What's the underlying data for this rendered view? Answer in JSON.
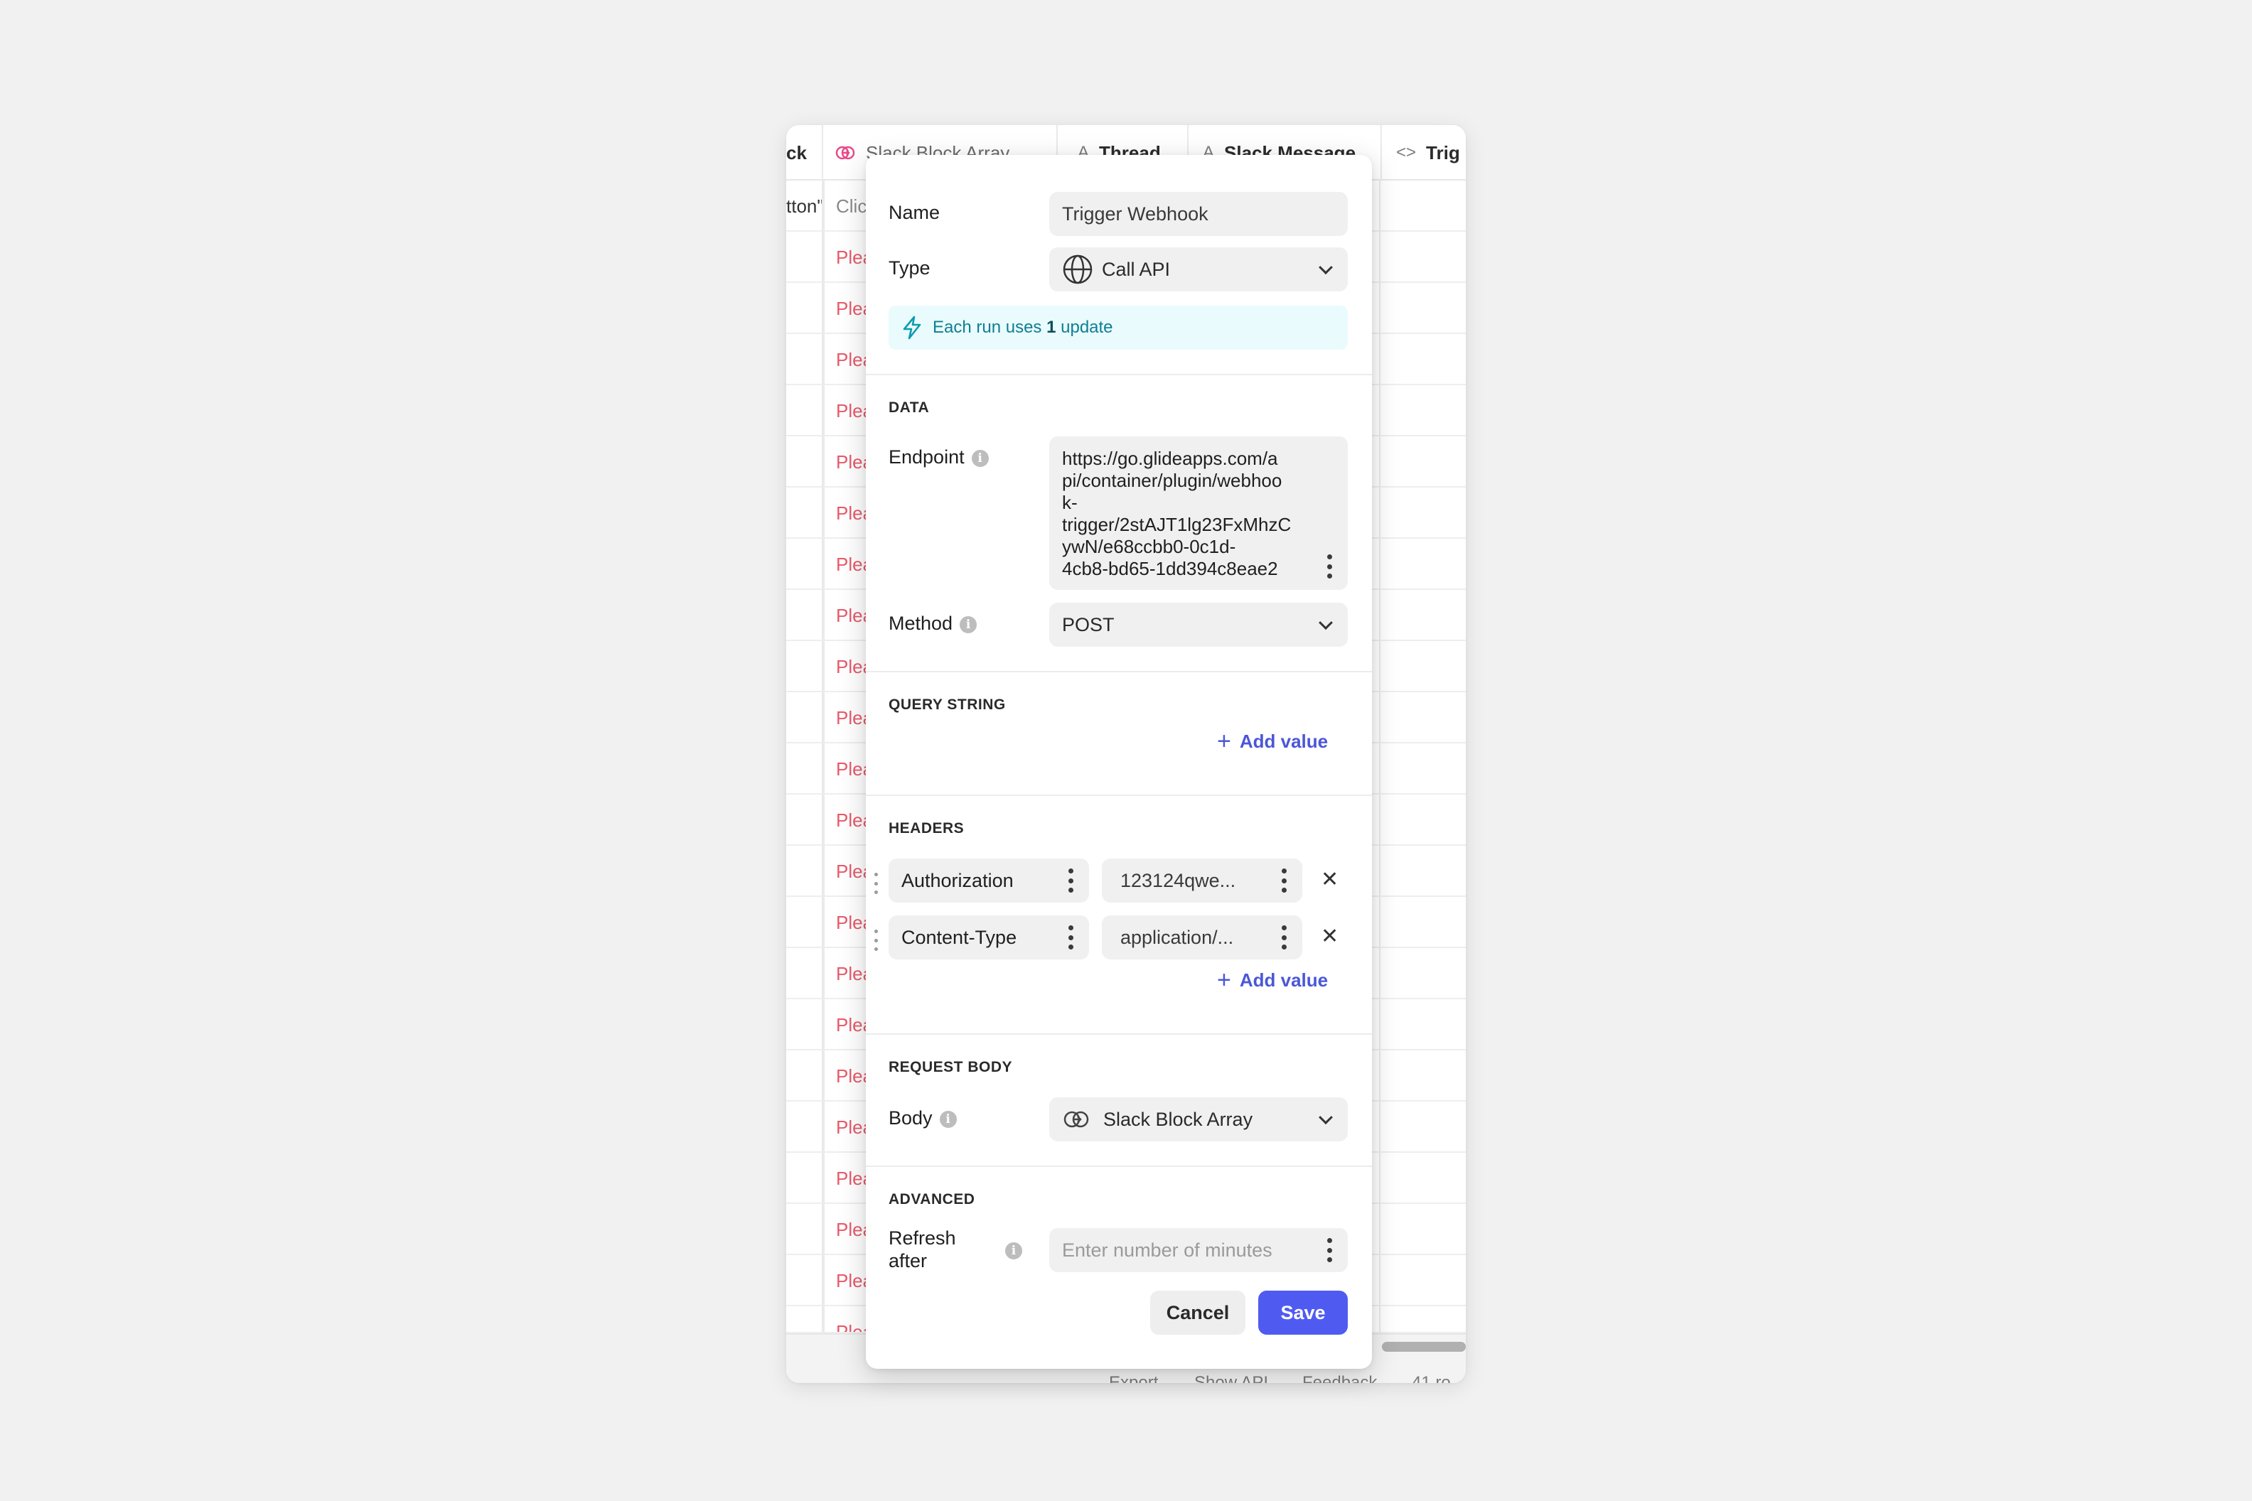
{
  "table": {
    "columns": [
      {
        "label": "ck",
        "icon": ""
      },
      {
        "label": "Slack Block Array",
        "icon": "slack-array-icon"
      },
      {
        "label": "Thread",
        "icon": "text-icon"
      },
      {
        "label": "Slack Message",
        "icon": "text-icon"
      },
      {
        "label": "Trig",
        "icon": "code-icon"
      }
    ],
    "first_row": {
      "col_a": "tton\"",
      "col_b": "Clic"
    },
    "row_text": "Plea",
    "row_last": "Plea",
    "footer": {
      "export": "Export",
      "show_api": "Show API",
      "feedback": "Feedback",
      "rows": "41 ro"
    }
  },
  "dialog": {
    "name_label": "Name",
    "name_value": "Trigger Webhook",
    "type_label": "Type",
    "type_value": "Call API",
    "update_notice": {
      "prefix": "Each run uses ",
      "count": "1",
      "suffix": " update"
    },
    "sections": {
      "data": "DATA",
      "query": "QUERY STRING",
      "headers": "HEADERS",
      "body": "REQUEST BODY",
      "advanced": "ADVANCED"
    },
    "endpoint_label": "Endpoint",
    "endpoint_lines": [
      "https://go.glideapps.com/a",
      "pi/container/plugin/webhoo",
      "k-",
      "trigger/2stAJT1lg23FxMhzC",
      "ywN/e68ccbb0-0c1d-",
      "4cb8-bd65-1dd394c8eae2"
    ],
    "method_label": "Method",
    "method_value": "POST",
    "add_value": "Add value",
    "headers": [
      {
        "key": "Authorization",
        "value": "123124qwe..."
      },
      {
        "key": "Content-Type",
        "value": "application/..."
      }
    ],
    "body_label": "Body",
    "body_value": "Slack Block Array",
    "refresh_label_1": "Refresh",
    "refresh_label_2": "after",
    "refresh_placeholder": "Enter number of minutes",
    "cancel": "Cancel",
    "save": "Save",
    "colors": {
      "accent": "#4f5bf0",
      "notice_bg": "#eafbfd",
      "notice_text": "#0e7f93",
      "error_text": "#e85a6a"
    }
  }
}
